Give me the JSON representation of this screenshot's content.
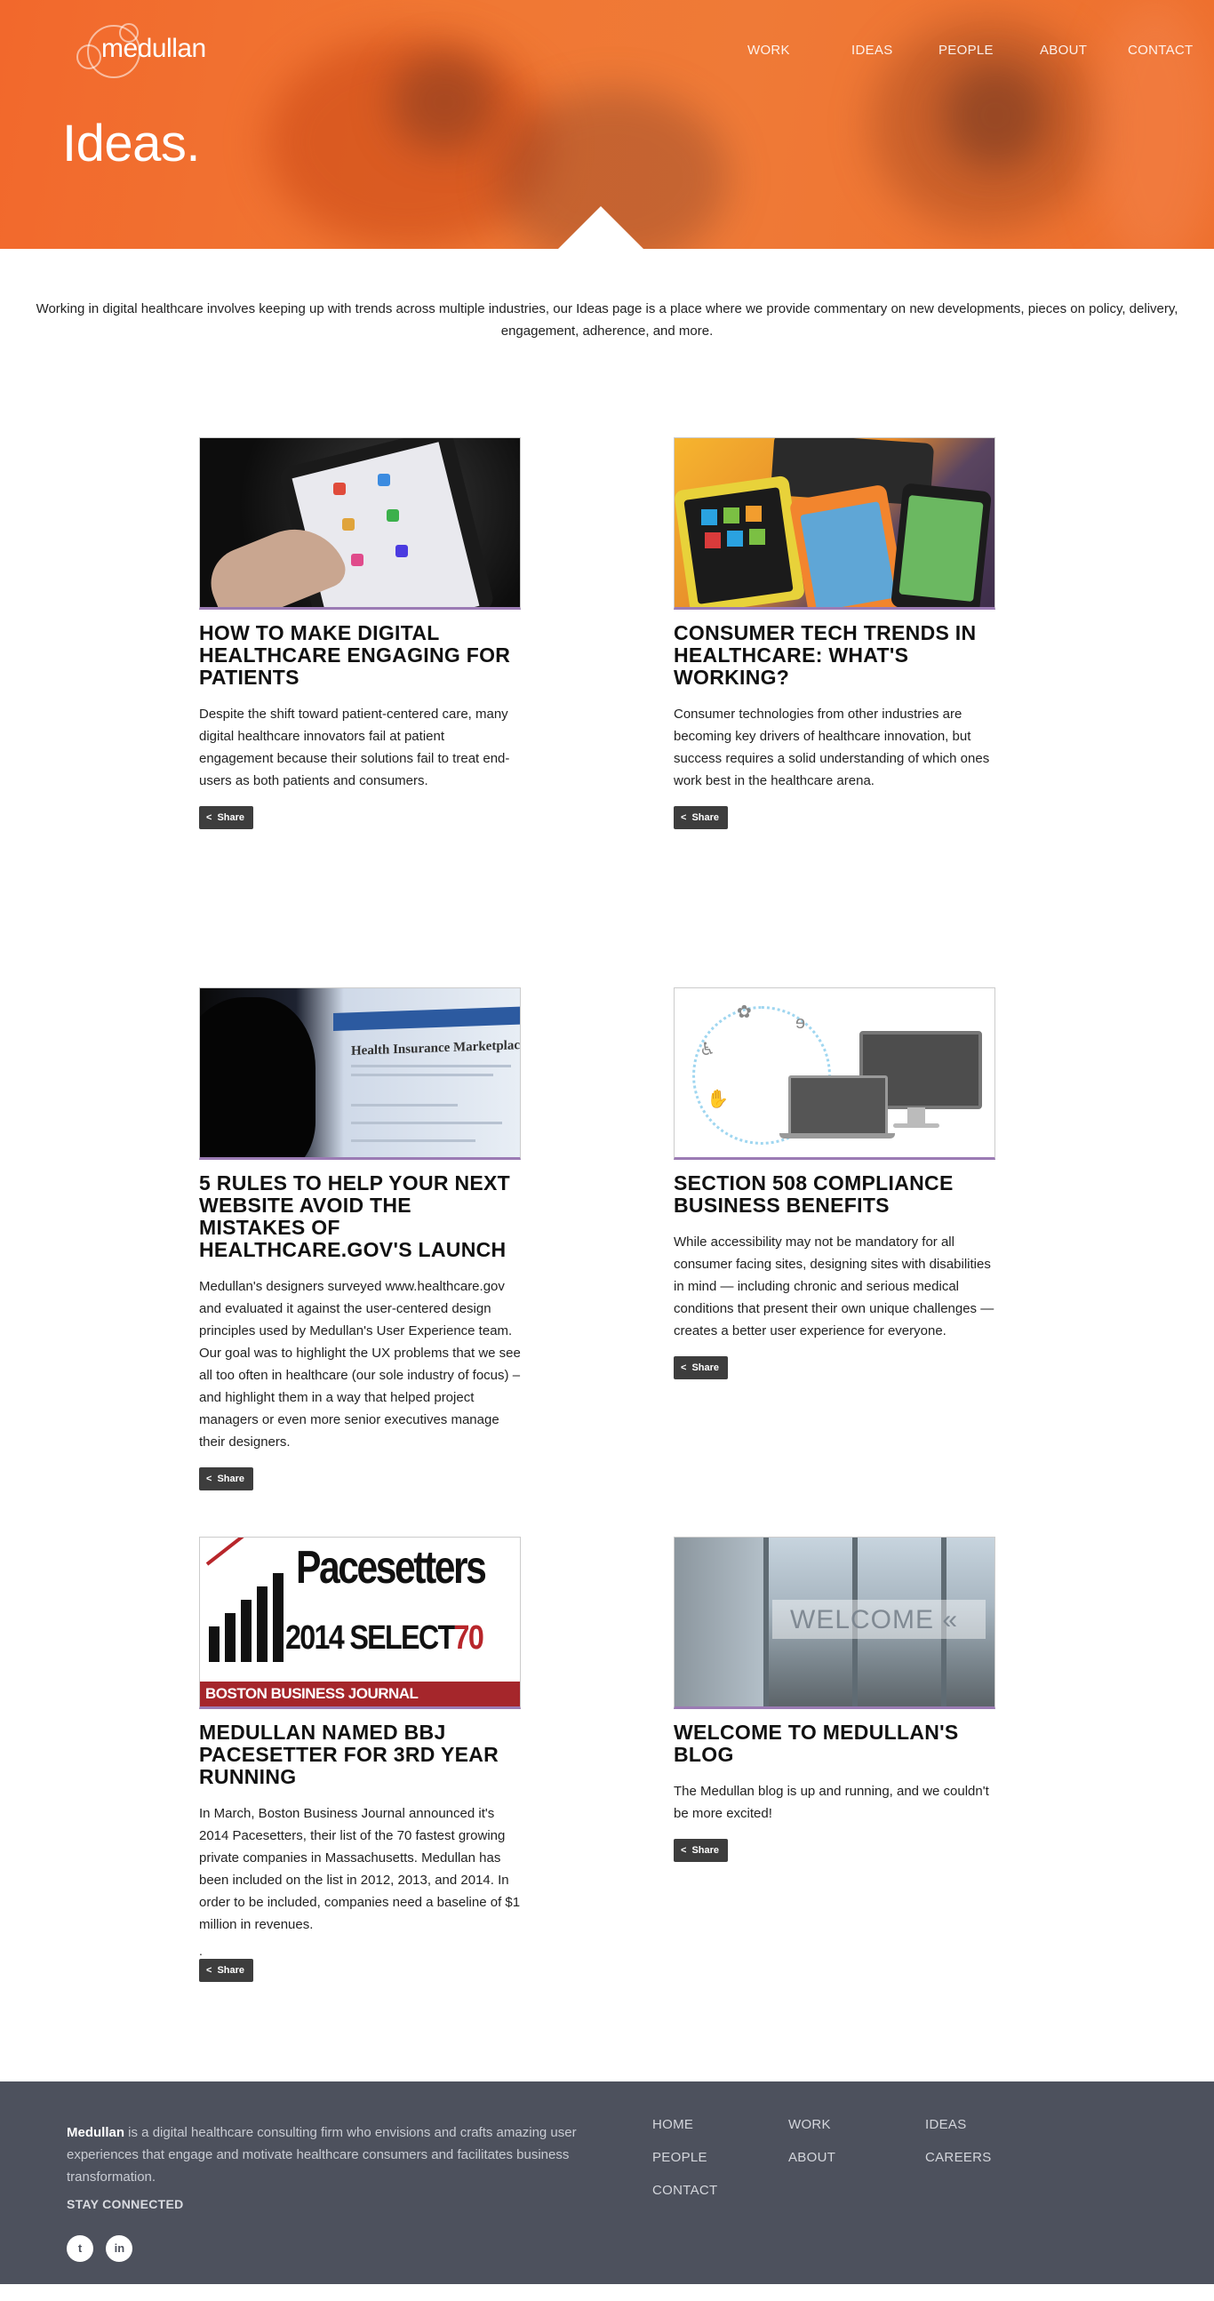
{
  "brand": {
    "logo_text": "medullan"
  },
  "nav": {
    "items": [
      "WORK",
      "IDEAS",
      "PEOPLE",
      "ABOUT",
      "CONTACT"
    ]
  },
  "hero": {
    "title": "Ideas."
  },
  "intro": "Working in digital healthcare involves keeping up with trends across multiple industries, our Ideas page is a place where we provide commentary on new developments, pieces on policy, delivery, engagement, adherence, and more.",
  "share_label": "Share",
  "articles": [
    {
      "title": "HOW TO MAKE DIGITAL HEALTHCARE ENGAGING FOR PATIENTS",
      "excerpt": "Despite the shift toward patient-centered care, many digital healthcare innovators fail at patient engagement because their solutions fail to treat end-users as both patients and consumers."
    },
    {
      "title": "CONSUMER TECH TRENDS IN HEALTHCARE: WHAT'S WORKING?",
      "excerpt": "Consumer technologies from other industries are becoming key drivers of healthcare innovation, but success requires a solid understanding of which ones work best in the healthcare arena."
    },
    {
      "title": "5 RULES TO HELP YOUR NEXT WEBSITE AVOID THE MISTAKES OF HEALTHCARE.GOV'S LAUNCH",
      "excerpt": "Medullan's designers surveyed www.healthcare.gov and evaluated it against the user-centered design principles used by Medullan's User Experience team. Our goal was to highlight the UX problems that we see all too often in healthcare (our sole industry of focus) – and highlight them in a way that helped project managers or even more senior executives manage their designers."
    },
    {
      "title": "SECTION 508 COMPLIANCE BUSINESS BENEFITS",
      "excerpt": "While accessibility may not be mandatory for all consumer facing sites, designing sites with disabilities in mind — including chronic and serious medical conditions that present their own unique challenges — creates a better user experience for everyone."
    },
    {
      "title": "MEDULLAN NAMED BBJ PACESETTER FOR 3RD YEAR RUNNING",
      "excerpt": "In March, Boston Business Journal announced it's 2014 Pacesetters, their list of the 70 fastest growing private companies in Massachusetts.  Medullan has been included on the list in 2012, 2013, and 2014.   In order to be included, companies need a baseline of $1 million in revenues.",
      "trailing": "."
    },
    {
      "title": "WELCOME TO MEDULLAN'S BLOG",
      "excerpt": "The Medullan blog is up and running, and we couldn't be more excited!"
    }
  ],
  "thumbs": {
    "t3_heading": "Health Insurance Marketplace: Please wait",
    "t5_pace": "Pacesetters",
    "t5_year": "2014 SELECT",
    "t5_year70": "70",
    "t5_bbj": "BOSTON BUSINESS JOURNAL",
    "t6_welcome": "WELCOME"
  },
  "footer": {
    "brand": "Medullan",
    "about": " is a digital healthcare consulting firm who envisions and crafts amazing user experiences that engage and motivate healthcare consumers and facilitates business transformation.",
    "stay_connected": "STAY CONNECTED",
    "social": [
      "twitter-icon",
      "linkedin-icon"
    ],
    "links": [
      "HOME",
      "WORK",
      "IDEAS",
      "PEOPLE",
      "ABOUT",
      "CAREERS",
      "CONTACT"
    ]
  },
  "colors": {
    "hero_orange": "#f07733",
    "footer_bg": "#4d515d",
    "accent_purple": "#9b7bb4",
    "share_bg": "#3d3d3d"
  }
}
